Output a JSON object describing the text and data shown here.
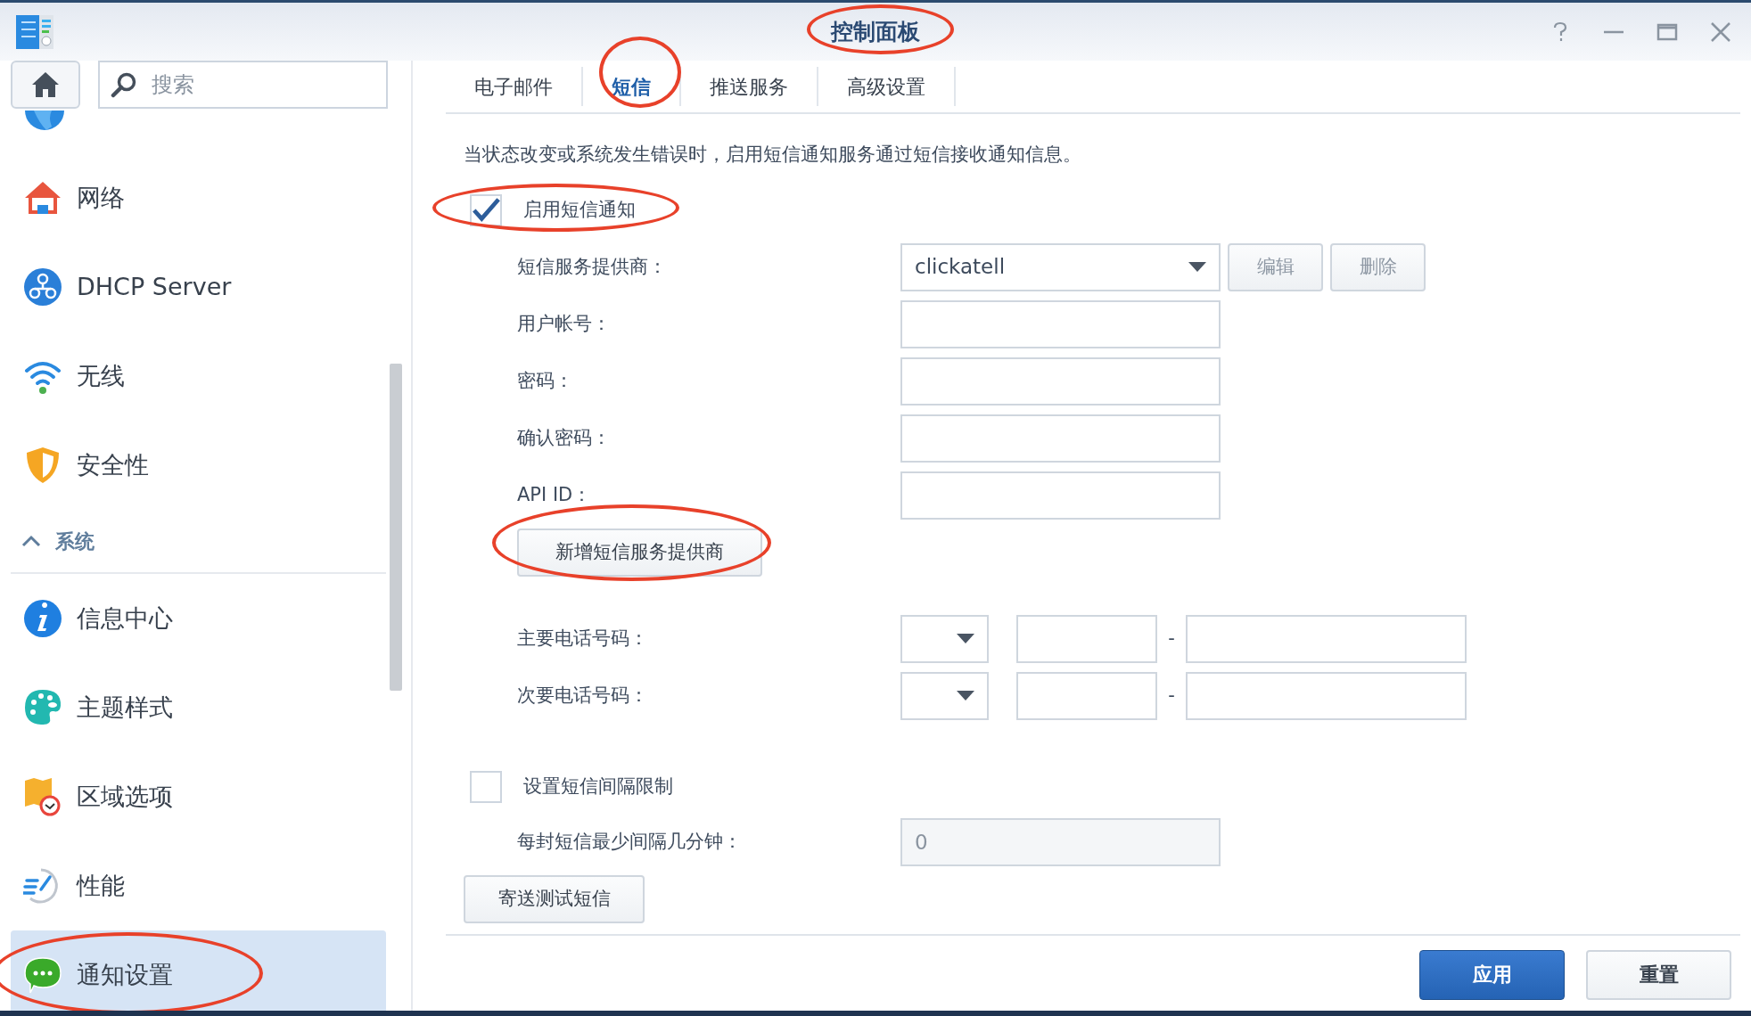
{
  "window": {
    "title": "控制面板"
  },
  "sidebar": {
    "search": {
      "placeholder": "搜索"
    },
    "items": [
      {
        "kind": "item",
        "label": "网络",
        "selected": false
      },
      {
        "kind": "item",
        "label": "DHCP Server",
        "selected": false
      },
      {
        "kind": "item",
        "label": "无线",
        "selected": false
      },
      {
        "kind": "item",
        "label": "安全性",
        "selected": false
      },
      {
        "kind": "group",
        "label": "系统",
        "expanded": true
      },
      {
        "kind": "item",
        "label": "信息中心",
        "selected": false
      },
      {
        "kind": "item",
        "label": "主题样式",
        "selected": false
      },
      {
        "kind": "item",
        "label": "区域选项",
        "selected": false
      },
      {
        "kind": "item",
        "label": "性能",
        "selected": false
      },
      {
        "kind": "item",
        "label": "通知设置",
        "selected": true
      }
    ]
  },
  "tabs": [
    {
      "label": "电子邮件",
      "selected": false
    },
    {
      "label": "短信",
      "selected": true
    },
    {
      "label": "推送服务",
      "selected": false
    },
    {
      "label": "高级设置",
      "selected": false
    }
  ],
  "description": "当状态改变或系统发生错误时，启用短信通知服务通过短信接收通知信息。",
  "enable_sms": {
    "label": "启用短信通知",
    "checked": true
  },
  "provider": {
    "label": "短信服务提供商：",
    "value": "clickatell",
    "buttons": [
      {
        "label": "编辑",
        "disabled": true
      },
      {
        "label": "删除",
        "disabled": true
      }
    ]
  },
  "fields": [
    {
      "label": "用户帐号："
    },
    {
      "label": "密码："
    },
    {
      "label": "确认密码："
    },
    {
      "label": "API ID："
    }
  ],
  "add_provider_button": "新增短信服务提供商",
  "phones": [
    {
      "label": "主要电话号码：",
      "separator": "-"
    },
    {
      "label": "次要电话号码：",
      "separator": "-"
    }
  ],
  "interval_limit": {
    "label": "设置短信间隔限制",
    "checked": false
  },
  "interval": {
    "label": "每封短信最少间隔几分钟：",
    "value": "0",
    "disabled": true
  },
  "test_button": "寄送测试短信",
  "footer_buttons": [
    {
      "kind": "primary",
      "label": "应用"
    },
    {
      "kind": "secondary",
      "label": "重置"
    }
  ]
}
